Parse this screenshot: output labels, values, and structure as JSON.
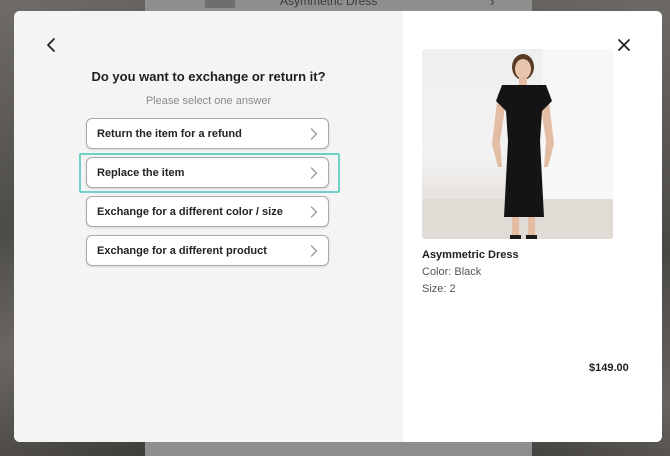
{
  "background": {
    "product_title": "Asymmetric Dress"
  },
  "modal": {
    "question": "Do you want to exchange or return it?",
    "hint": "Please select one answer",
    "options": [
      {
        "label": "Return the item for a refund"
      },
      {
        "label": "Replace the item",
        "focused": true
      },
      {
        "label": "Exchange for a different color / size"
      },
      {
        "label": "Exchange for a different product"
      }
    ],
    "icons": {
      "back": "chevron-left-icon",
      "close": "close-icon",
      "option_arrow": "chevron-right-icon"
    }
  },
  "product": {
    "name": "Asymmetric Dress",
    "color": "Color: Black",
    "size": "Size: 2",
    "price": "$149.00"
  },
  "colors": {
    "focus_ring": "#6fd2c6",
    "panel_left": "#f4f4f4",
    "panel_right": "#ffffff"
  }
}
